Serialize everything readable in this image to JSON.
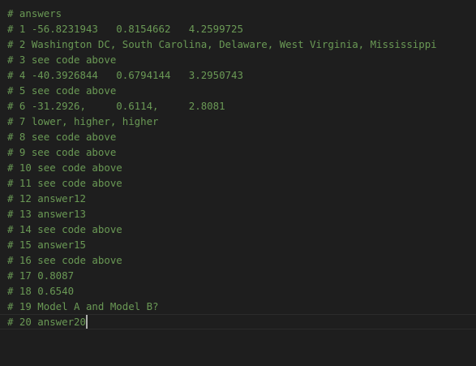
{
  "editor": {
    "lines": [
      "# answers",
      "# 1 -56.8231943   0.8154662   4.2599725",
      "# 2 Washington DC, South Carolina, Delaware, West Virginia, Mississippi",
      "# 3 see code above",
      "# 4 -40.3926844   0.6794144   3.2950743",
      "# 5 see code above",
      "# 6 -31.2926,     0.6114,     2.8081",
      "# 7 lower, higher, higher",
      "# 8 see code above",
      "# 9 see code above",
      "# 10 see code above",
      "# 11 see code above",
      "# 12 answer12",
      "# 13 answer13",
      "# 14 see code above",
      "# 15 answer15",
      "# 16 see code above",
      "# 17 0.8087",
      "# 18 0.6540",
      "# 19 Model A and Model B?",
      "# 20 answer20"
    ],
    "comment_color": "#6a9955",
    "background_color": "#1e1e1e"
  }
}
